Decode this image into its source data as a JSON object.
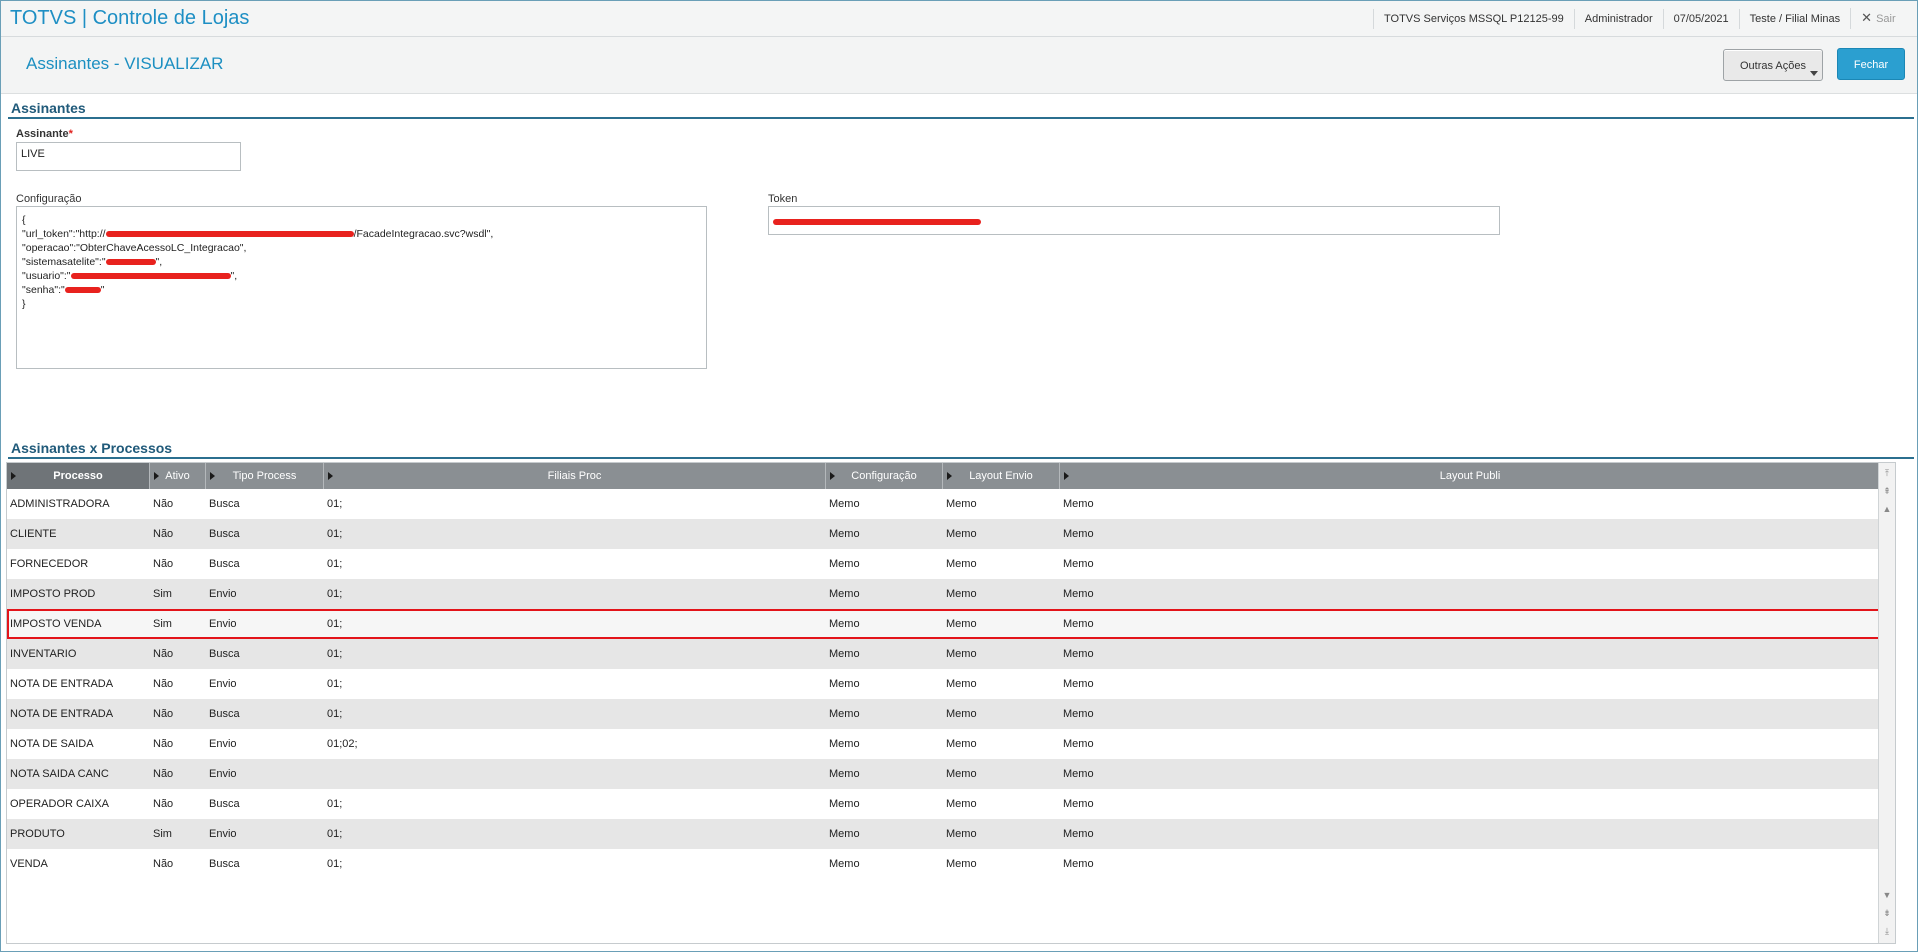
{
  "topbar": {
    "app_title": "TOTVS | Controle de Lojas",
    "environment": "TOTVS Serviços MSSQL P12125-99",
    "user": "Administrador",
    "date": "07/05/2021",
    "branch": "Teste / Filial Minas",
    "exit_icon": "close-icon",
    "exit_label": "Sair"
  },
  "header": {
    "page_title": "Assinantes - VISUALIZAR",
    "more_actions_label": "Outras Ações",
    "close_label": "Fechar"
  },
  "section1": {
    "title": "Assinantes",
    "assinante_label": "Assinante",
    "required_mark": "*",
    "assinante_value": "LIVE",
    "config_label": "Configuração",
    "config_lines": {
      "l1": "{",
      "l2a": "\"url_token\":\"http://",
      "l2b": "/FacadeIntegracao.svc?wsdl\",",
      "l3": "\"operacao\":\"ObterChaveAcessoLC_Integracao\",",
      "l4a": "\"sistemasatelite\":\"",
      "l4b": "\",",
      "l5a": "\"usuario\":\"",
      "l5b": "\",",
      "l6a": "\"senha\":\"",
      "l6b": "\"",
      "l7": "}"
    },
    "token_label": "Token"
  },
  "section2": {
    "title": "Assinantes x Processos",
    "columns": [
      "Processo",
      "Ativo",
      "Tipo Process",
      "Filiais Proc",
      "Configuração",
      "Layout Envio",
      "Layout Publi"
    ],
    "rows": [
      [
        "ADMINISTRADORA",
        "Não",
        "Busca",
        "01;",
        "Memo",
        "Memo",
        "Memo"
      ],
      [
        "CLIENTE",
        "Não",
        "Busca",
        "01;",
        "Memo",
        "Memo",
        "Memo"
      ],
      [
        "FORNECEDOR",
        "Não",
        "Busca",
        "01;",
        "Memo",
        "Memo",
        "Memo"
      ],
      [
        "IMPOSTO PROD",
        "Sim",
        "Envio",
        "01;",
        "Memo",
        "Memo",
        "Memo"
      ],
      [
        "IMPOSTO VENDA",
        "Sim",
        "Envio",
        "01;",
        "Memo",
        "Memo",
        "Memo"
      ],
      [
        "INVENTARIO",
        "Não",
        "Busca",
        "01;",
        "Memo",
        "Memo",
        "Memo"
      ],
      [
        "NOTA DE ENTRADA",
        "Não",
        "Envio",
        "01;",
        "Memo",
        "Memo",
        "Memo"
      ],
      [
        "NOTA DE ENTRADA",
        "Não",
        "Busca",
        "01;",
        "Memo",
        "Memo",
        "Memo"
      ],
      [
        "NOTA DE SAIDA",
        "Não",
        "Envio",
        "01;02;",
        "Memo",
        "Memo",
        "Memo"
      ],
      [
        "NOTA SAIDA CANC",
        "Não",
        "Envio",
        "",
        "Memo",
        "Memo",
        "Memo"
      ],
      [
        "OPERADOR CAIXA",
        "Não",
        "Busca",
        "01;",
        "Memo",
        "Memo",
        "Memo"
      ],
      [
        "PRODUTO",
        "Sim",
        "Envio",
        "01;",
        "Memo",
        "Memo",
        "Memo"
      ],
      [
        "VENDA",
        "Não",
        "Busca",
        "01;",
        "Memo",
        "Memo",
        "Memo"
      ]
    ],
    "selected_row": 4
  },
  "colors": {
    "accent": "#1e8fc4",
    "section_title": "#205a7a",
    "header_grid": "#8a8f93",
    "highlight": "#e3141a"
  }
}
